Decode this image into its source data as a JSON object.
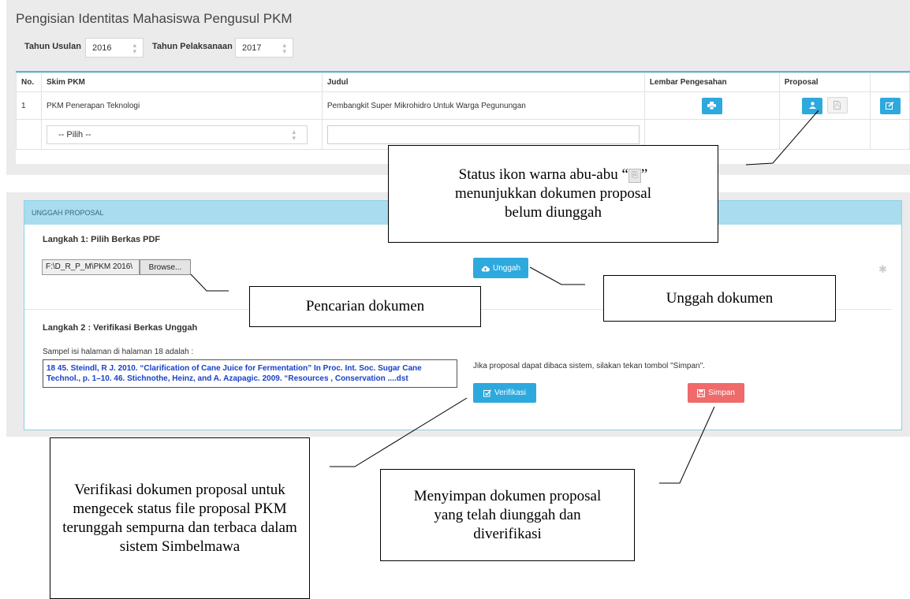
{
  "page_title": "Pengisian Identitas Mahasiswa Pengusul PKM",
  "filters": {
    "tahun_usulan_label": "Tahun Usulan",
    "tahun_usulan_value": "2016",
    "tahun_pelaksanaan_label": "Tahun Pelaksanaan",
    "tahun_pelaksanaan_value": "2017"
  },
  "table": {
    "headers": [
      "No.",
      "Skim PKM",
      "Judul",
      "Lembar Pengesahan",
      "Proposal",
      ""
    ],
    "row": {
      "no": "1",
      "skim": "PKM Penerapan Teknologi",
      "judul": "Pembangkit Super Mikrohidro Untuk Warga Pegunungan"
    },
    "new_row": {
      "skim_placeholder": "-- Pilih --",
      "judul_value": ""
    }
  },
  "upload": {
    "header": "UNGGAH PROPOSAL",
    "step1_title": "Langkah 1: Pilih Berkas PDF",
    "file_path": "F:\\D_R_P_M\\PKM 2016\\",
    "browse_label": "Browse...",
    "unggah_label": "Unggah",
    "step2_title": "Langkah 2 : Verifikasi Berkas Unggah",
    "sample_label": "Sampel isi halaman di halaman 18 adalah :",
    "sample_text_line1": "18 45. Steindl, R J. 2010. “Clarification of Cane Juice for Fermentation” In Proc. Int. Soc. Sugar Cane",
    "sample_text_line2": "Technol., p. 1–10. 46. Stichnothe, Heinz, and A. Azapagic. 2009. “Resources , Conservation ....dst",
    "simpan_hint": "Jika proposal dapat dibaca sistem, silakan tekan tombol \"Simpan\".",
    "verifikasi_label": "Verifikasi",
    "simpan_label": "Simpan"
  },
  "callouts": {
    "status_line1a": "Status ikon warna abu-abu “",
    "status_line1b": "”",
    "status_line2": "menunjukkan dokumen proposal",
    "status_line3": "belum diunggah",
    "pencarian": "Pencarian dokumen",
    "unggah": "Unggah dokumen",
    "verifikasi": "Verifikasi dokumen proposal untuk mengecek status file proposal PKM terunggah sempurna dan terbaca dalam sistem Simbelmawa",
    "menyimpan": "Menyimpan dokumen proposal yang telah diunggah dan diverifikasi"
  },
  "colors": {
    "primary_button": "#2ea9dd",
    "danger_button": "#ef6a6a",
    "panel_header": "#a8dcee",
    "link_text": "#1840c8"
  },
  "icons": {
    "print": "print-icon",
    "upload_user": "upload-icon",
    "pdf": "pdf-file-icon",
    "edit": "edit-icon",
    "cloud_upload": "cloud-upload-icon",
    "check": "check-square-icon",
    "save": "save-icon",
    "star": "star-icon"
  }
}
